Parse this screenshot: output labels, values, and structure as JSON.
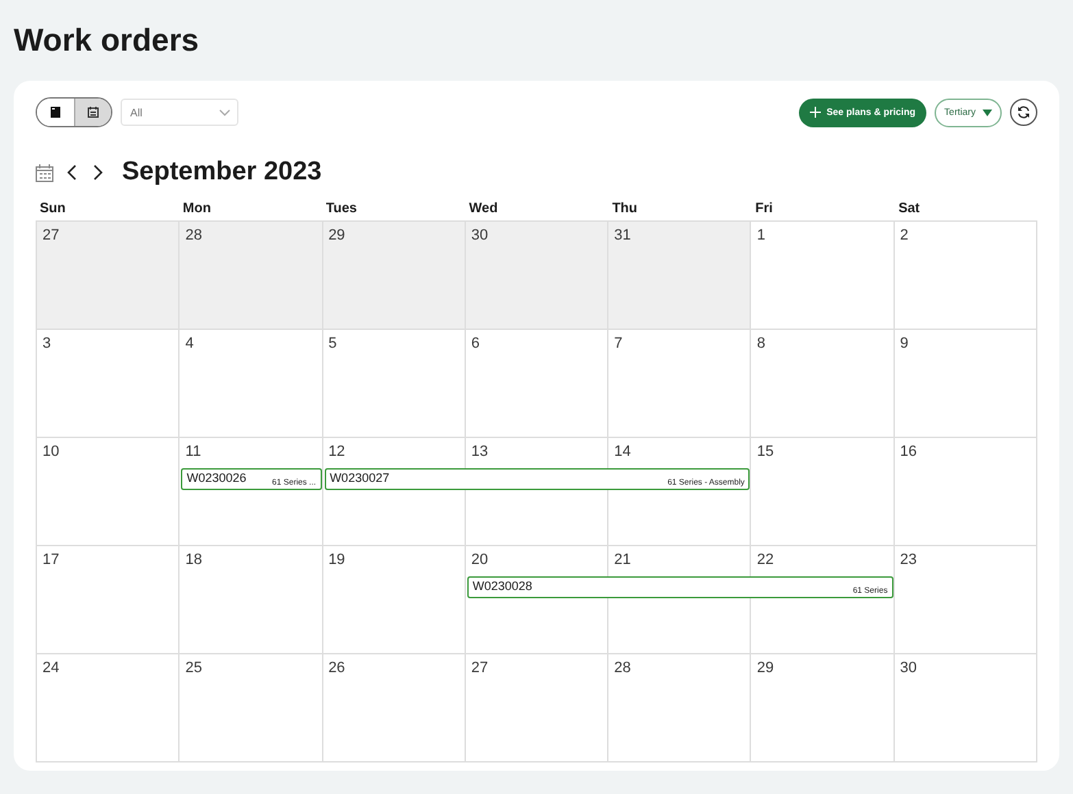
{
  "page_title": "Work orders",
  "toolbar": {
    "views": [
      {
        "kind": "list",
        "selected": false
      },
      {
        "kind": "calendar",
        "selected": true
      }
    ],
    "filter": {
      "placeholder": "All"
    },
    "plans_button": "See plans & pricing",
    "tertiary_button": "Tertiary"
  },
  "calendar": {
    "month": "September 2023",
    "weekdays": [
      "Sun",
      "Mon",
      "Tues",
      "Wed",
      "Thu",
      "Fri",
      "Sat"
    ],
    "weeks": [
      {
        "days": [
          {
            "label": "27",
            "outside": true
          },
          {
            "label": "28",
            "outside": true
          },
          {
            "label": "29",
            "outside": true
          },
          {
            "label": "30",
            "outside": true
          },
          {
            "label": "31",
            "outside": true
          },
          {
            "label": "1"
          },
          {
            "label": "2"
          }
        ]
      },
      {
        "days": [
          {
            "label": "3"
          },
          {
            "label": "4"
          },
          {
            "label": "5"
          },
          {
            "label": "6"
          },
          {
            "label": "7"
          },
          {
            "label": "8"
          },
          {
            "label": "9"
          }
        ]
      },
      {
        "days": [
          {
            "label": "10"
          },
          {
            "label": "11",
            "event": {
              "code": "W0230026",
              "series": "61 Series ..."
            }
          },
          {
            "label": "12",
            "event": {
              "code": "W0230027",
              "series": "61 Series - Assembly"
            }
          },
          {
            "label": "13",
            "event_continues": true
          },
          {
            "label": "14",
            "event_continues": true
          },
          {
            "label": "15"
          },
          {
            "label": "16"
          }
        ]
      },
      {
        "days": [
          {
            "label": "17"
          },
          {
            "label": "18"
          },
          {
            "label": "19"
          },
          {
            "label": "20",
            "event": {
              "code": "W0230028",
              "series": "61 Series"
            }
          },
          {
            "label": "21",
            "event_continues": true
          },
          {
            "label": "22",
            "event_continues": true
          },
          {
            "label": "23"
          }
        ]
      },
      {
        "days": [
          {
            "label": "24"
          },
          {
            "label": "25"
          },
          {
            "label": "26"
          },
          {
            "label": "27"
          },
          {
            "label": "28"
          },
          {
            "label": "29"
          },
          {
            "label": "30"
          }
        ]
      }
    ]
  }
}
